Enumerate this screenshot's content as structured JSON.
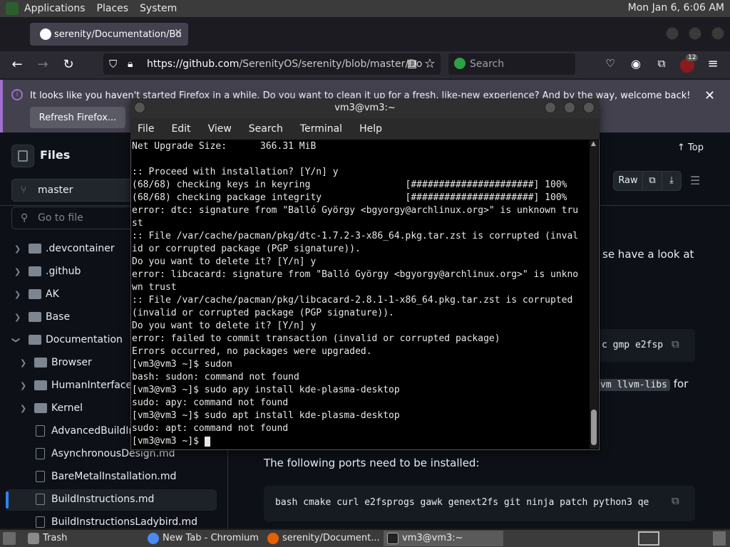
{
  "system_panel": {
    "menus": [
      "Applications",
      "Places",
      "System"
    ],
    "clock": "Mon Jan  6,  6:06 AM"
  },
  "browser": {
    "tab_title": "serenity/Documentation/Bu",
    "url_domain": "https://github.com",
    "url_path": "/SerenityOS/serenity/blob/master/Do",
    "search_placeholder": "Search",
    "notification_text": "It looks like you haven't started Firefox in a while. Do you want to clean it up for a fresh, like-new experience? And by the way, welcome back!",
    "refresh_label": "Refresh Firefox...",
    "extension_badge": "12"
  },
  "github": {
    "files_title": "Files",
    "branch": "master",
    "goto_placeholder": "Go to file",
    "tree": [
      {
        "label": ".devcontainer",
        "type": "folder"
      },
      {
        "label": ".github",
        "type": "folder"
      },
      {
        "label": "AK",
        "type": "folder"
      },
      {
        "label": "Base",
        "type": "folder"
      },
      {
        "label": "Documentation",
        "type": "folder-open"
      },
      {
        "label": "Browser",
        "type": "folder"
      },
      {
        "label": "HumanInterfaceG",
        "type": "folder"
      },
      {
        "label": "Kernel",
        "type": "folder"
      },
      {
        "label": "AdvancedBuildIns",
        "type": "file"
      },
      {
        "label": "AsynchronousDesign.md",
        "type": "file"
      },
      {
        "label": "BareMetalInstallation.md",
        "type": "file"
      },
      {
        "label": "BuildInstructions.md",
        "type": "file"
      },
      {
        "label": "BuildInstructionsLadybird.md",
        "type": "file"
      }
    ],
    "top_label": "Top",
    "raw_label": "Raw",
    "text_partial": "se have a look at",
    "code1_partial": "c gmp e2fsp",
    "code_inline": "vm llvm-libs",
    "text_for": "for",
    "ports_text": "The following ports need to be installed:",
    "ports_code": "bash cmake curl e2fsprogs gawk genext2fs git ninja patch python3 qe"
  },
  "terminal": {
    "title": "vm3@vm3:~",
    "menus": [
      "File",
      "Edit",
      "View",
      "Search",
      "Terminal",
      "Help"
    ],
    "lines": [
      "Net Upgrade Size:      366.31 MiB",
      "",
      ":: Proceed with installation? [Y/n] y",
      "(68/68) checking keys in keyring                 [######################] 100%",
      "(68/68) checking package integrity               [######################] 100%",
      "error: dtc: signature from \"Balló György <bgyorgy@archlinux.org>\" is unknown tru",
      "st",
      ":: File /var/cache/pacman/pkg/dtc-1.7.2-3-x86_64.pkg.tar.zst is corrupted (inval",
      "id or corrupted package (PGP signature)).",
      "Do you want to delete it? [Y/n] y",
      "error: libcacard: signature from \"Balló György <bgyorgy@archlinux.org>\" is unkno",
      "wn trust",
      ":: File /var/cache/pacman/pkg/libcacard-2.8.1-1-x86_64.pkg.tar.zst is corrupted",
      "(invalid or corrupted package (PGP signature)).",
      "Do you want to delete it? [Y/n] y",
      "error: failed to commit transaction (invalid or corrupted package)",
      "Errors occurred, no packages were upgraded.",
      "[vm3@vm3 ~]$ sudon",
      "bash: sudon: command not found",
      "[vm3@vm3 ~]$ sudo apy install kde-plasma-desktop",
      "sudo: apy: command not found",
      "[vm3@vm3 ~]$ sudo apt install kde-plasma-desktop",
      "sudo: apt: command not found",
      "[vm3@vm3 ~]$ "
    ]
  },
  "taskbar": {
    "items": [
      "Trash",
      "New Tab - Chromium",
      "serenity/Document...",
      "vm3@vm3:~"
    ]
  }
}
